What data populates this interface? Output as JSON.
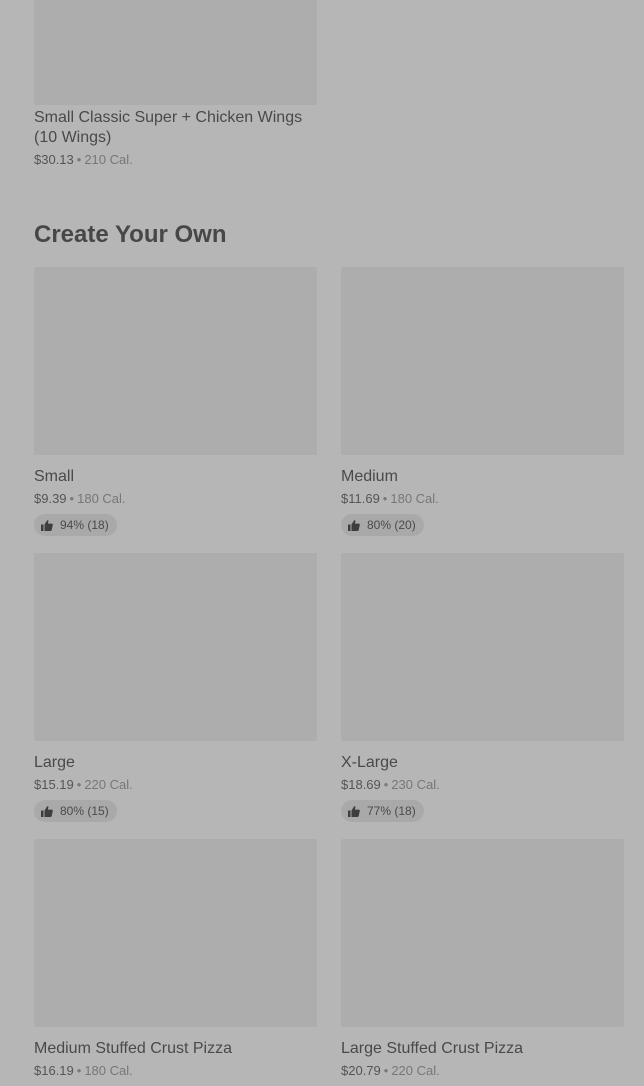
{
  "top_item": {
    "name": "Small Classic Super + Chicken Wings (10 Wings)",
    "price": "$30.13",
    "calories": "210 Cal."
  },
  "section": {
    "title": "Create Your Own"
  },
  "separator": "•",
  "items": [
    {
      "name": "Small",
      "price": "$9.39",
      "calories": "180 Cal.",
      "rating": "94% (18)"
    },
    {
      "name": "Medium",
      "price": "$11.69",
      "calories": "180 Cal.",
      "rating": "80% (20)"
    },
    {
      "name": "Large",
      "price": "$15.19",
      "calories": "220 Cal.",
      "rating": "80% (15)"
    },
    {
      "name": "X-Large",
      "price": "$18.69",
      "calories": "230 Cal.",
      "rating": "77% (18)"
    },
    {
      "name": "Medium Stuffed Crust Pizza",
      "price": "$16.19",
      "calories": "180 Cal."
    },
    {
      "name": "Large Stuffed Crust Pizza",
      "price": "$20.79",
      "calories": "220 Cal."
    }
  ],
  "icons": {
    "rating": "thumbs-up-icon"
  }
}
